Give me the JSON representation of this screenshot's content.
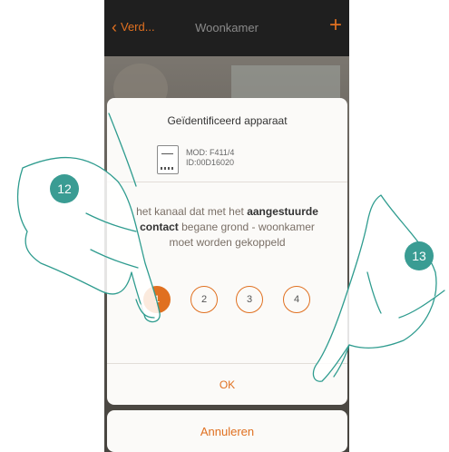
{
  "topbar": {
    "back_label": "Verd...",
    "title": "Woonkamer",
    "add_label": "+"
  },
  "dialog": {
    "title": "Geïdentificeerd apparaat",
    "mod": "MOD: F411/4",
    "id": "ID:00D16020",
    "desc_1": "het kanaal dat met het ",
    "desc_bold_1": "aangestuurde",
    "desc_bold_2": "contact",
    "desc_2": " begane grond - woonkamer",
    "desc_3": "moet worden gekoppeld",
    "channels": [
      "1",
      "2",
      "3",
      "4"
    ],
    "ok_label": "OK"
  },
  "cancel_label": "Annuleren",
  "badges": [
    "12",
    "13"
  ],
  "colors": {
    "accent": "#e07020",
    "badge": "#3a9c93",
    "topbar": "#1f1f1f"
  }
}
